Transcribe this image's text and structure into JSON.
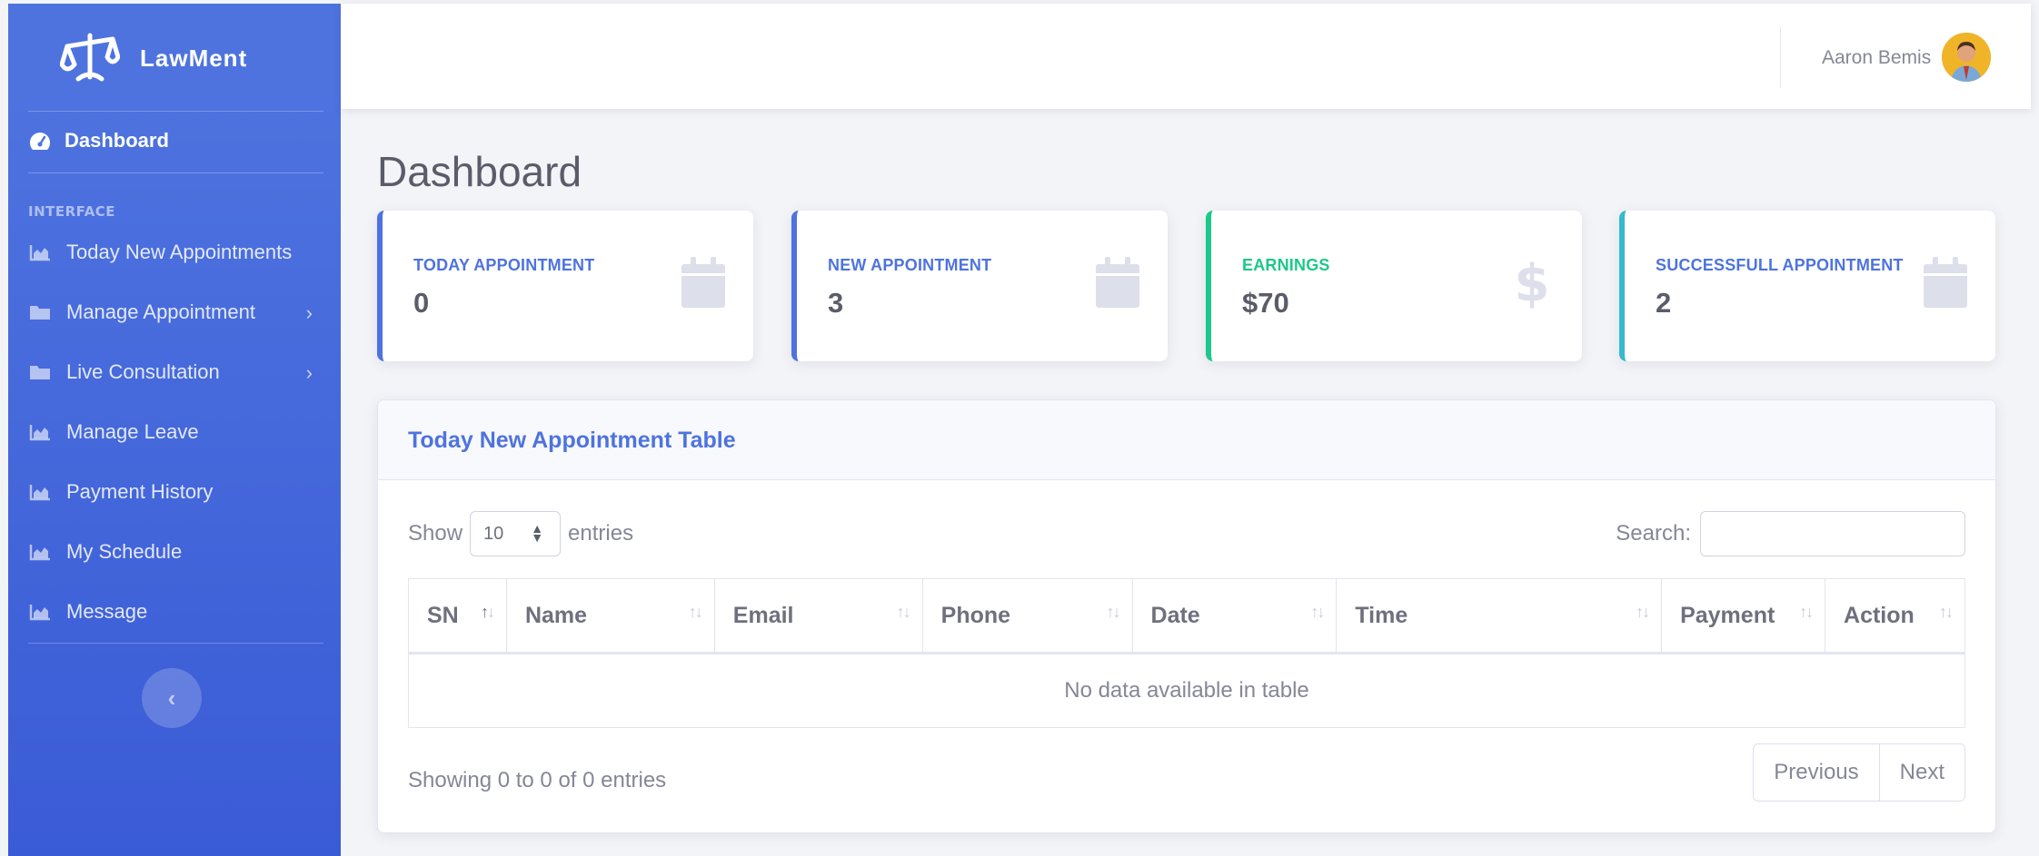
{
  "brand": {
    "name": "LawMent"
  },
  "sidebar": {
    "dashboard_label": "Dashboard",
    "heading": "INTERFACE",
    "items": [
      {
        "label": "Today New Appointments",
        "icon": "chart-area-icon",
        "has_submenu": false
      },
      {
        "label": "Manage Appointment",
        "icon": "folder-icon",
        "has_submenu": true
      },
      {
        "label": "Live Consultation",
        "icon": "folder-icon",
        "has_submenu": true
      },
      {
        "label": "Manage Leave",
        "icon": "chart-area-icon",
        "has_submenu": false
      },
      {
        "label": "Payment History",
        "icon": "chart-area-icon",
        "has_submenu": false
      },
      {
        "label": "My Schedule",
        "icon": "chart-area-icon",
        "has_submenu": false
      },
      {
        "label": "Message",
        "icon": "chart-area-icon",
        "has_submenu": false
      }
    ],
    "toggle_icon": "chevron-left-icon"
  },
  "topbar": {
    "user_name": "Aaron Bemis"
  },
  "page": {
    "title": "Dashboard"
  },
  "cards": [
    {
      "label": "TODAY APPOINTMENT",
      "value": "0",
      "icon": "calendar-icon",
      "color": "#4e73df"
    },
    {
      "label": "NEW APPOINTMENT",
      "value": "3",
      "icon": "calendar-icon",
      "color": "#4e73df"
    },
    {
      "label": "EARNINGS",
      "value": "$70",
      "icon": "dollar-icon",
      "color": "#1cc88a"
    },
    {
      "label": "SUCCESSFULL APPOINTMENT",
      "value": "2",
      "icon": "calendar-icon",
      "color": "#36b9cc"
    }
  ],
  "table_card": {
    "title": "Today New Appointment Table",
    "show_label": "Show",
    "page_length": "10",
    "entries_label": "entries",
    "search_label": "Search:",
    "search_value": "",
    "columns": [
      "SN",
      "Name",
      "Email",
      "Phone",
      "Date",
      "Time",
      "Payment",
      "Action"
    ],
    "empty_message": "No data available in table",
    "info": "Showing 0 to 0 of 0 entries",
    "prev_label": "Previous",
    "next_label": "Next"
  },
  "colors": {
    "primary": "#4e73df",
    "success": "#1cc88a",
    "info": "#36b9cc",
    "icon_muted": "#dddfeb"
  }
}
